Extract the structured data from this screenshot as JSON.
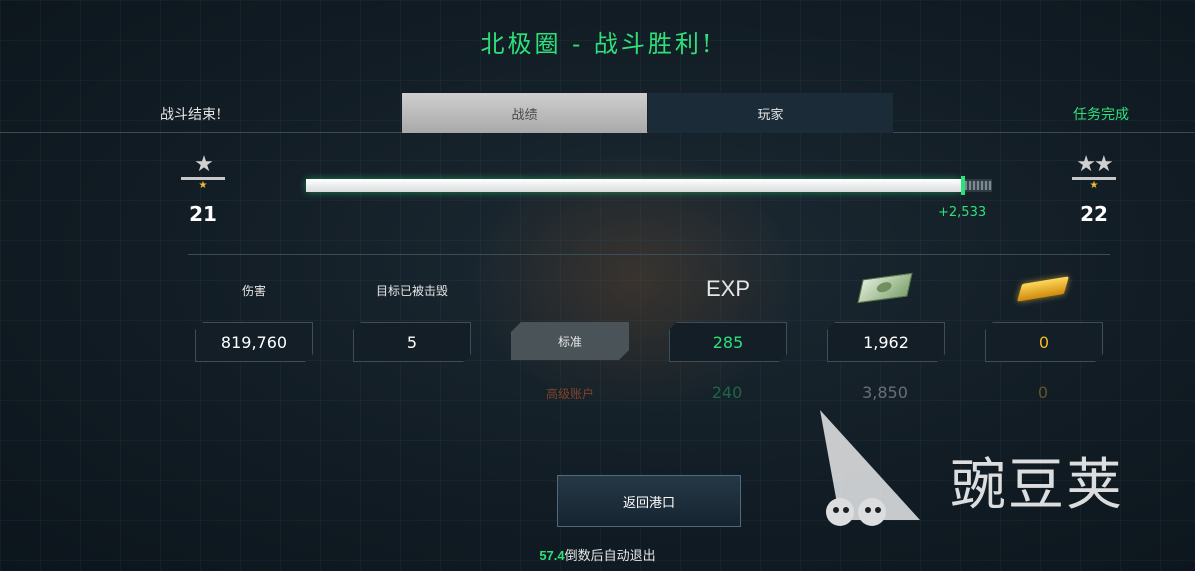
{
  "title": "北极圈 - 战斗胜利!",
  "header": {
    "battle_status": "战斗结束!",
    "mission_status": "任务完成",
    "tabs": [
      {
        "label": "战绩",
        "active": true
      },
      {
        "label": "玩家",
        "active": false
      }
    ]
  },
  "rank": {
    "current": {
      "level": "21",
      "stars": "★"
    },
    "next": {
      "level": "22",
      "stars": "★★"
    }
  },
  "progress": {
    "fill_fraction": 0.955,
    "gain_text": "+2,533"
  },
  "columns": {
    "damage": "伤害",
    "targets_destroyed": "目标已被击毁",
    "exp": "EXP",
    "cash_icon": "cash-icon",
    "gold_icon": "gold-icon"
  },
  "standard_row": {
    "label": "标准",
    "damage": "819,760",
    "targets": "5",
    "exp": "285",
    "cash": "1,962",
    "gold": "0"
  },
  "premium_row": {
    "label": "高级账户",
    "exp": "240",
    "cash": "3,850",
    "gold": "0"
  },
  "return_button": "返回港口",
  "countdown": {
    "seconds": "57.4",
    "suffix": "倒数后自动退出"
  },
  "watermark": {
    "text": "豌豆荚"
  },
  "colors": {
    "accent_green": "#2ee07a",
    "gold": "#f2b92b"
  }
}
